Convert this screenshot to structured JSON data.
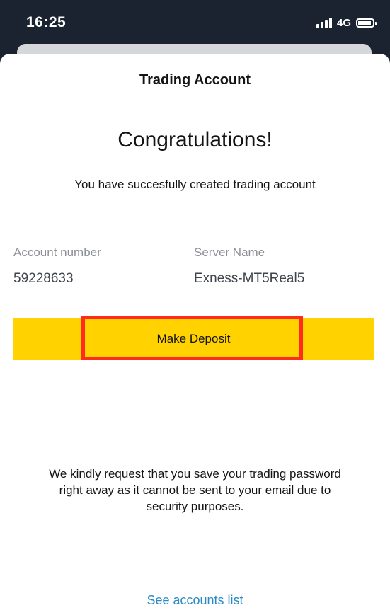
{
  "status_bar": {
    "time": "16:25",
    "network": "4G"
  },
  "sheet": {
    "title": "Trading Account",
    "heading": "Congratulations!",
    "message": "You have succesfully created trading account"
  },
  "account": {
    "number_label": "Account number",
    "number_value": "59228633",
    "server_label": "Server Name",
    "server_value": "Exness-MT5Real5"
  },
  "deposit_button": {
    "label": "Make Deposit"
  },
  "notice": {
    "line1": "We kindly request that you save your trading password",
    "line2": "right away as it cannot be sent to your email due to",
    "line3": "security purposes."
  },
  "footer": {
    "accounts_link": "See accounts list"
  },
  "colors": {
    "button_yellow": "#ffd200",
    "highlight_red": "#ff2b1b",
    "link_blue": "#2a8ac4",
    "status_bar_bg": "#1b2330"
  },
  "icons": [
    "signal-icon",
    "battery-icon"
  ]
}
